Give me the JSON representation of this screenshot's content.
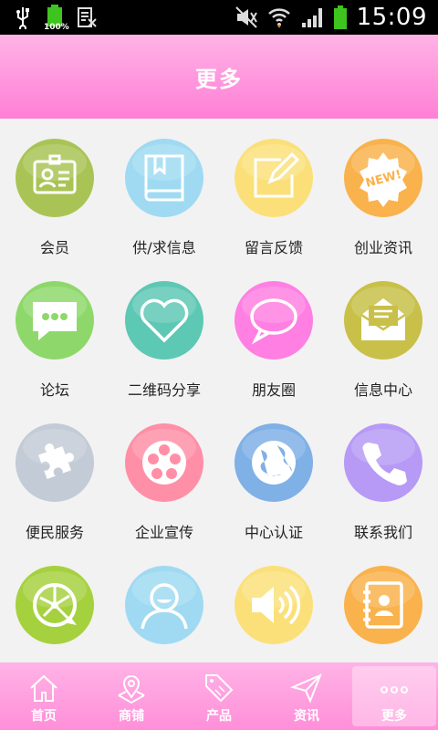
{
  "status_bar": {
    "time": "15:09",
    "battery_small_text": "100%",
    "icons": [
      "usb-icon",
      "battery-full-icon",
      "clipboard-icon",
      "mute-icon",
      "wifi-icon",
      "signal-icon",
      "battery-icon"
    ]
  },
  "header": {
    "title": "更多"
  },
  "menu": [
    {
      "label": "会员",
      "icon": "member-card-icon",
      "color": "#a9c454"
    },
    {
      "label": "供/求信息",
      "icon": "book-icon",
      "color": "#9fdaf2"
    },
    {
      "label": "留言反馈",
      "icon": "edit-note-icon",
      "color": "#fbe07a"
    },
    {
      "label": "创业资讯",
      "icon": "new-badge-icon",
      "color": "#f9b24c"
    },
    {
      "label": "论坛",
      "icon": "chat-bubble-icon",
      "color": "#8ed86b"
    },
    {
      "label": "二维码分享",
      "icon": "heart-icon",
      "color": "#5dc8b4"
    },
    {
      "label": "朋友圈",
      "icon": "speech-bubble-icon",
      "color": "#ff7fe2"
    },
    {
      "label": "信息中心",
      "icon": "mail-icon",
      "color": "#c8c048"
    },
    {
      "label": "便民服务",
      "icon": "puzzle-icon",
      "color": "#c3cbd6"
    },
    {
      "label": "企业宣传",
      "icon": "film-reel-icon",
      "color": "#ff8fa6"
    },
    {
      "label": "中心认证",
      "icon": "globe-icon",
      "color": "#7fb0e6"
    },
    {
      "label": "联系我们",
      "icon": "phone-icon",
      "color": "#b69af5"
    },
    {
      "label": "",
      "icon": "network-icon",
      "color": "#a6d13f"
    },
    {
      "label": "",
      "icon": "user-avatar-icon",
      "color": "#9fdaf2"
    },
    {
      "label": "",
      "icon": "speaker-icon",
      "color": "#fbe07a"
    },
    {
      "label": "",
      "icon": "contacts-book-icon",
      "color": "#f9b24c"
    }
  ],
  "bottom_nav": [
    {
      "label": "首页",
      "icon": "home-icon"
    },
    {
      "label": "商铺",
      "icon": "shop-map-icon"
    },
    {
      "label": "产品",
      "icon": "sale-tag-icon"
    },
    {
      "label": "资讯",
      "icon": "send-icon"
    },
    {
      "label": "更多",
      "icon": "more-dots-icon",
      "active": true
    }
  ]
}
